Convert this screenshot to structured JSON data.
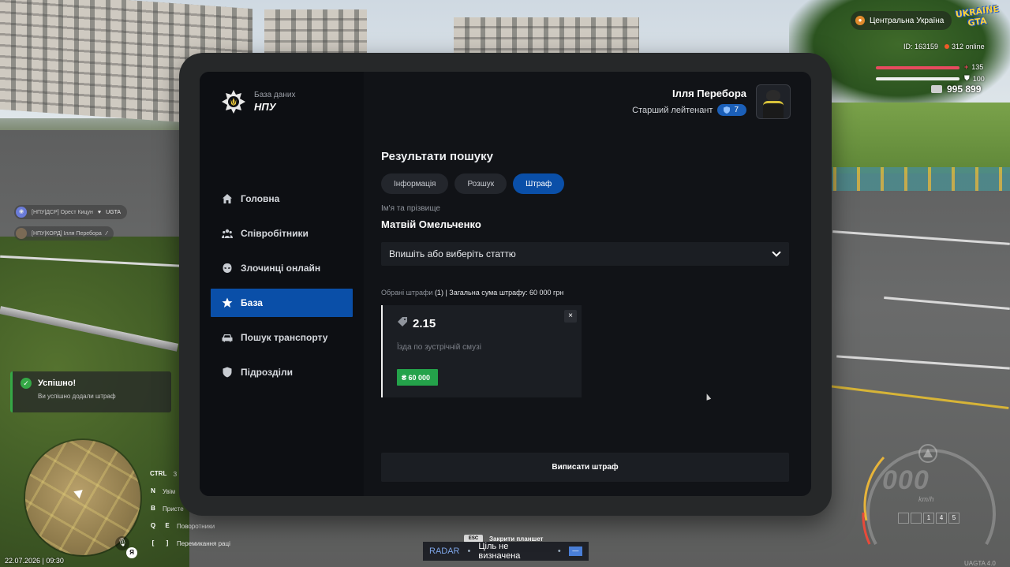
{
  "hud": {
    "region": "Центральна Україна",
    "logo_line1": "UKRAINE",
    "logo_line2": "GTA",
    "player_id": "ID: 163159",
    "online": "312 online",
    "health": "135",
    "armor": "100",
    "money": "995 899",
    "datetime": "22.07.2026 | 09:30",
    "voice_key": "Я",
    "version": "UAGTA 4.0"
  },
  "chat": [
    {
      "tag": "[НПУ|ДСР] Орест Кицун",
      "extra": "UGTA"
    },
    {
      "tag": "[НПУ|КОРД] Ілля Перебора",
      "extra": ""
    }
  ],
  "toast": {
    "title": "Успішно!",
    "text": "Ви успішно додали штраф"
  },
  "keybinds": [
    {
      "keys": [
        "CTRL"
      ],
      "label": "З"
    },
    {
      "keys": [
        "N"
      ],
      "label": "Увім"
    },
    {
      "keys": [
        "B"
      ],
      "label": "Присте"
    },
    {
      "keys": [
        "Q",
        "E"
      ],
      "label": "Поворотники"
    },
    {
      "keys": [
        "[",
        "]"
      ],
      "label": "Перемикання раці"
    }
  ],
  "radar": {
    "title": "RADAR",
    "status": "Ціль не визначена",
    "button": "—"
  },
  "esc_hint": {
    "key": "ESC",
    "label": "Закрити планшет"
  },
  "speedometer": {
    "speed": "000",
    "unit": "km/h",
    "gears": [
      "",
      "",
      "1",
      "4",
      "5"
    ]
  },
  "tablet": {
    "brand_sub": "База даних",
    "brand_name": "НПУ",
    "nav": [
      {
        "label": "Головна",
        "icon": "home-icon",
        "active": false
      },
      {
        "label": "Співробітники",
        "icon": "users-icon",
        "active": false
      },
      {
        "label": "Злочинці онлайн",
        "icon": "mask-icon",
        "active": false
      },
      {
        "label": "База",
        "icon": "star-icon",
        "active": true
      },
      {
        "label": "Пошук транспорту",
        "icon": "car-icon",
        "active": false
      },
      {
        "label": "Підрозділи",
        "icon": "shield-icon",
        "active": false
      }
    ],
    "user": {
      "name": "Ілля Перебора",
      "rank": "Старший лейтенант",
      "rank_level": "7"
    },
    "section_title": "Результати пошуку",
    "tabs": [
      {
        "label": "Інформація",
        "active": false
      },
      {
        "label": "Розшук",
        "active": false
      },
      {
        "label": "Штраф",
        "active": true
      }
    ],
    "name_label": "Ім'я та прізвище",
    "name_value": "Матвій Омельченко",
    "select_placeholder": "Впишіть або виберіть статтю",
    "summary_label": "Обрані штрафи",
    "summary_value": "(1) | Загальна сума штрафу: 60 000 грн",
    "fine": {
      "code": "2.15",
      "description": "Їзда по зустрічній смузі",
      "amount": "₴ 60 000",
      "close": "×"
    },
    "submit_label": "Виписати штраф"
  }
}
